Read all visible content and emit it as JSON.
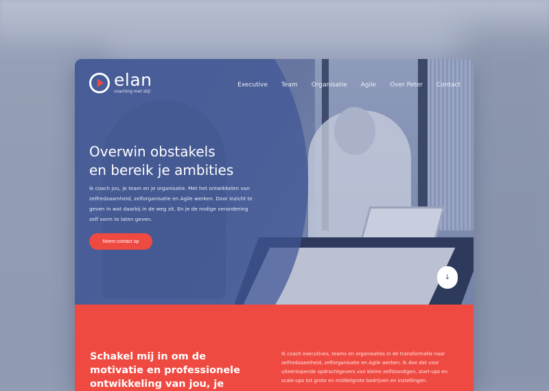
{
  "brand": {
    "name": "elan",
    "tagline": "coaching met stijl"
  },
  "nav": {
    "items": [
      "Executive",
      "Team",
      "Organisatie",
      "Agile",
      "Over Peter",
      "Contact"
    ]
  },
  "hero": {
    "title_line1": "Overwin obstakels",
    "title_line2": "en bereik je ambities",
    "text": "Ik coach jou, je team en je organisatie. Met het ontwikkelen van zelfredzaamheid, zelforganisatie en Agile werken. Door inzicht te geven in wat daarbij in de weg zit. En je de nodige verandering zelf vorm te laten geven.",
    "cta_label": "Neem contact op",
    "scroll_icon": "↓"
  },
  "section": {
    "title": "Schakel mij in om de motivatie en professionele ontwikkeling van jou, je team of je",
    "text": "Ik coach executives, teams en organisaties in de transformatie naar zelfredzaamheid, zelforganisatie en Agile werken. Ik doe dat voor uiteenlopende opdrachtgevers van kleine zelfstandigen, start-ups en scale-ups tot grote en middelgrote bedrijven en instellingen."
  },
  "colors": {
    "accent": "#ef4a42",
    "hero_overlay": "#4056a0",
    "text_light": "#ffffff"
  }
}
